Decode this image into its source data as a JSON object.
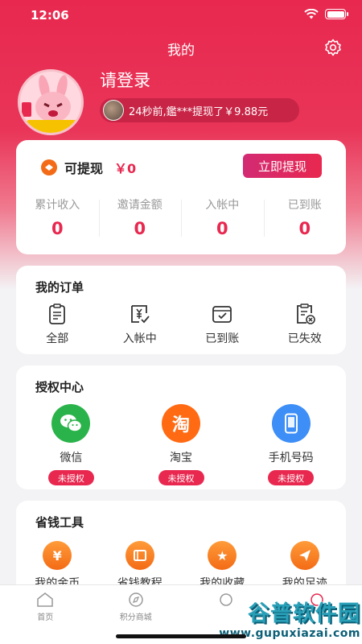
{
  "status_bar": {
    "time": "12:06"
  },
  "header": {
    "title": "我的"
  },
  "profile": {
    "login_text": "请登录",
    "ticker": "24秒前,鑑***提现了￥9.88元"
  },
  "wallet": {
    "label": "可提现",
    "amount": "￥0",
    "withdraw_button": "立即提现",
    "stats": [
      {
        "label": "累计收入",
        "value": "0"
      },
      {
        "label": "邀请金额",
        "value": "0"
      },
      {
        "label": "入帐中",
        "value": "0"
      },
      {
        "label": "已到账",
        "value": "0"
      }
    ]
  },
  "orders": {
    "title": "我的订单",
    "items": [
      {
        "label": "全部",
        "icon": "clipboard-icon"
      },
      {
        "label": "入帐中",
        "icon": "yen-check-icon"
      },
      {
        "label": "已到账",
        "icon": "tray-check-icon"
      },
      {
        "label": "已失效",
        "icon": "clipboard-x-icon"
      }
    ]
  },
  "auth_center": {
    "title": "授权中心",
    "items": [
      {
        "name": "微信",
        "badge": "未授权",
        "icon": "wechat-icon",
        "color": "#2bb34b"
      },
      {
        "name": "淘宝",
        "badge": "未授权",
        "icon": "taobao-icon",
        "glyph": "淘",
        "color": "#ff6a13"
      },
      {
        "name": "手机号码",
        "badge": "未授权",
        "icon": "phone-icon",
        "color": "#3d8ef6"
      }
    ]
  },
  "tools": {
    "title": "省钱工具",
    "items": [
      {
        "label": "我的金币",
        "icon": "coin-icon",
        "glyph": "¥"
      },
      {
        "label": "省钱教程",
        "icon": "book-icon"
      },
      {
        "label": "我的收藏",
        "icon": "star-icon",
        "glyph": "★"
      },
      {
        "label": "我的足迹",
        "icon": "send-icon"
      }
    ]
  },
  "tabbar": {
    "items": [
      {
        "label": "首页",
        "icon": "home-icon"
      },
      {
        "label": "积分商城",
        "icon": "compass-icon"
      },
      {
        "label": "",
        "icon": "tab3-icon"
      },
      {
        "label": "",
        "icon": "tab4-icon"
      }
    ]
  },
  "watermark": {
    "main": "谷普软件园",
    "sub": "www.gupuxiazai.com"
  },
  "colors": {
    "primary": "#e8284f",
    "accent_orange": "#f36b16"
  }
}
